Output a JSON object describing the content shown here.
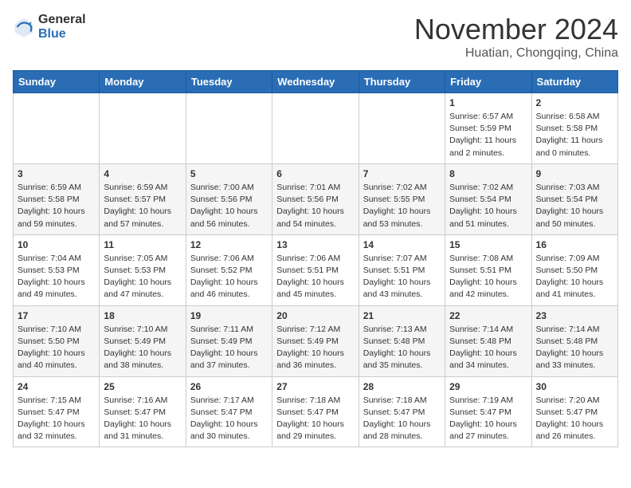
{
  "header": {
    "logo_general": "General",
    "logo_blue": "Blue",
    "month": "November 2024",
    "location": "Huatian, Chongqing, China"
  },
  "days_of_week": [
    "Sunday",
    "Monday",
    "Tuesday",
    "Wednesday",
    "Thursday",
    "Friday",
    "Saturday"
  ],
  "weeks": [
    [
      {
        "day": "",
        "sunrise": "",
        "sunset": "",
        "daylight": ""
      },
      {
        "day": "",
        "sunrise": "",
        "sunset": "",
        "daylight": ""
      },
      {
        "day": "",
        "sunrise": "",
        "sunset": "",
        "daylight": ""
      },
      {
        "day": "",
        "sunrise": "",
        "sunset": "",
        "daylight": ""
      },
      {
        "day": "",
        "sunrise": "",
        "sunset": "",
        "daylight": ""
      },
      {
        "day": "1",
        "sunrise": "Sunrise: 6:57 AM",
        "sunset": "Sunset: 5:59 PM",
        "daylight": "Daylight: 11 hours and 2 minutes."
      },
      {
        "day": "2",
        "sunrise": "Sunrise: 6:58 AM",
        "sunset": "Sunset: 5:58 PM",
        "daylight": "Daylight: 11 hours and 0 minutes."
      }
    ],
    [
      {
        "day": "3",
        "sunrise": "Sunrise: 6:59 AM",
        "sunset": "Sunset: 5:58 PM",
        "daylight": "Daylight: 10 hours and 59 minutes."
      },
      {
        "day": "4",
        "sunrise": "Sunrise: 6:59 AM",
        "sunset": "Sunset: 5:57 PM",
        "daylight": "Daylight: 10 hours and 57 minutes."
      },
      {
        "day": "5",
        "sunrise": "Sunrise: 7:00 AM",
        "sunset": "Sunset: 5:56 PM",
        "daylight": "Daylight: 10 hours and 56 minutes."
      },
      {
        "day": "6",
        "sunrise": "Sunrise: 7:01 AM",
        "sunset": "Sunset: 5:56 PM",
        "daylight": "Daylight: 10 hours and 54 minutes."
      },
      {
        "day": "7",
        "sunrise": "Sunrise: 7:02 AM",
        "sunset": "Sunset: 5:55 PM",
        "daylight": "Daylight: 10 hours and 53 minutes."
      },
      {
        "day": "8",
        "sunrise": "Sunrise: 7:02 AM",
        "sunset": "Sunset: 5:54 PM",
        "daylight": "Daylight: 10 hours and 51 minutes."
      },
      {
        "day": "9",
        "sunrise": "Sunrise: 7:03 AM",
        "sunset": "Sunset: 5:54 PM",
        "daylight": "Daylight: 10 hours and 50 minutes."
      }
    ],
    [
      {
        "day": "10",
        "sunrise": "Sunrise: 7:04 AM",
        "sunset": "Sunset: 5:53 PM",
        "daylight": "Daylight: 10 hours and 49 minutes."
      },
      {
        "day": "11",
        "sunrise": "Sunrise: 7:05 AM",
        "sunset": "Sunset: 5:53 PM",
        "daylight": "Daylight: 10 hours and 47 minutes."
      },
      {
        "day": "12",
        "sunrise": "Sunrise: 7:06 AM",
        "sunset": "Sunset: 5:52 PM",
        "daylight": "Daylight: 10 hours and 46 minutes."
      },
      {
        "day": "13",
        "sunrise": "Sunrise: 7:06 AM",
        "sunset": "Sunset: 5:51 PM",
        "daylight": "Daylight: 10 hours and 45 minutes."
      },
      {
        "day": "14",
        "sunrise": "Sunrise: 7:07 AM",
        "sunset": "Sunset: 5:51 PM",
        "daylight": "Daylight: 10 hours and 43 minutes."
      },
      {
        "day": "15",
        "sunrise": "Sunrise: 7:08 AM",
        "sunset": "Sunset: 5:51 PM",
        "daylight": "Daylight: 10 hours and 42 minutes."
      },
      {
        "day": "16",
        "sunrise": "Sunrise: 7:09 AM",
        "sunset": "Sunset: 5:50 PM",
        "daylight": "Daylight: 10 hours and 41 minutes."
      }
    ],
    [
      {
        "day": "17",
        "sunrise": "Sunrise: 7:10 AM",
        "sunset": "Sunset: 5:50 PM",
        "daylight": "Daylight: 10 hours and 40 minutes."
      },
      {
        "day": "18",
        "sunrise": "Sunrise: 7:10 AM",
        "sunset": "Sunset: 5:49 PM",
        "daylight": "Daylight: 10 hours and 38 minutes."
      },
      {
        "day": "19",
        "sunrise": "Sunrise: 7:11 AM",
        "sunset": "Sunset: 5:49 PM",
        "daylight": "Daylight: 10 hours and 37 minutes."
      },
      {
        "day": "20",
        "sunrise": "Sunrise: 7:12 AM",
        "sunset": "Sunset: 5:49 PM",
        "daylight": "Daylight: 10 hours and 36 minutes."
      },
      {
        "day": "21",
        "sunrise": "Sunrise: 7:13 AM",
        "sunset": "Sunset: 5:48 PM",
        "daylight": "Daylight: 10 hours and 35 minutes."
      },
      {
        "day": "22",
        "sunrise": "Sunrise: 7:14 AM",
        "sunset": "Sunset: 5:48 PM",
        "daylight": "Daylight: 10 hours and 34 minutes."
      },
      {
        "day": "23",
        "sunrise": "Sunrise: 7:14 AM",
        "sunset": "Sunset: 5:48 PM",
        "daylight": "Daylight: 10 hours and 33 minutes."
      }
    ],
    [
      {
        "day": "24",
        "sunrise": "Sunrise: 7:15 AM",
        "sunset": "Sunset: 5:47 PM",
        "daylight": "Daylight: 10 hours and 32 minutes."
      },
      {
        "day": "25",
        "sunrise": "Sunrise: 7:16 AM",
        "sunset": "Sunset: 5:47 PM",
        "daylight": "Daylight: 10 hours and 31 minutes."
      },
      {
        "day": "26",
        "sunrise": "Sunrise: 7:17 AM",
        "sunset": "Sunset: 5:47 PM",
        "daylight": "Daylight: 10 hours and 30 minutes."
      },
      {
        "day": "27",
        "sunrise": "Sunrise: 7:18 AM",
        "sunset": "Sunset: 5:47 PM",
        "daylight": "Daylight: 10 hours and 29 minutes."
      },
      {
        "day": "28",
        "sunrise": "Sunrise: 7:18 AM",
        "sunset": "Sunset: 5:47 PM",
        "daylight": "Daylight: 10 hours and 28 minutes."
      },
      {
        "day": "29",
        "sunrise": "Sunrise: 7:19 AM",
        "sunset": "Sunset: 5:47 PM",
        "daylight": "Daylight: 10 hours and 27 minutes."
      },
      {
        "day": "30",
        "sunrise": "Sunrise: 7:20 AM",
        "sunset": "Sunset: 5:47 PM",
        "daylight": "Daylight: 10 hours and 26 minutes."
      }
    ]
  ]
}
